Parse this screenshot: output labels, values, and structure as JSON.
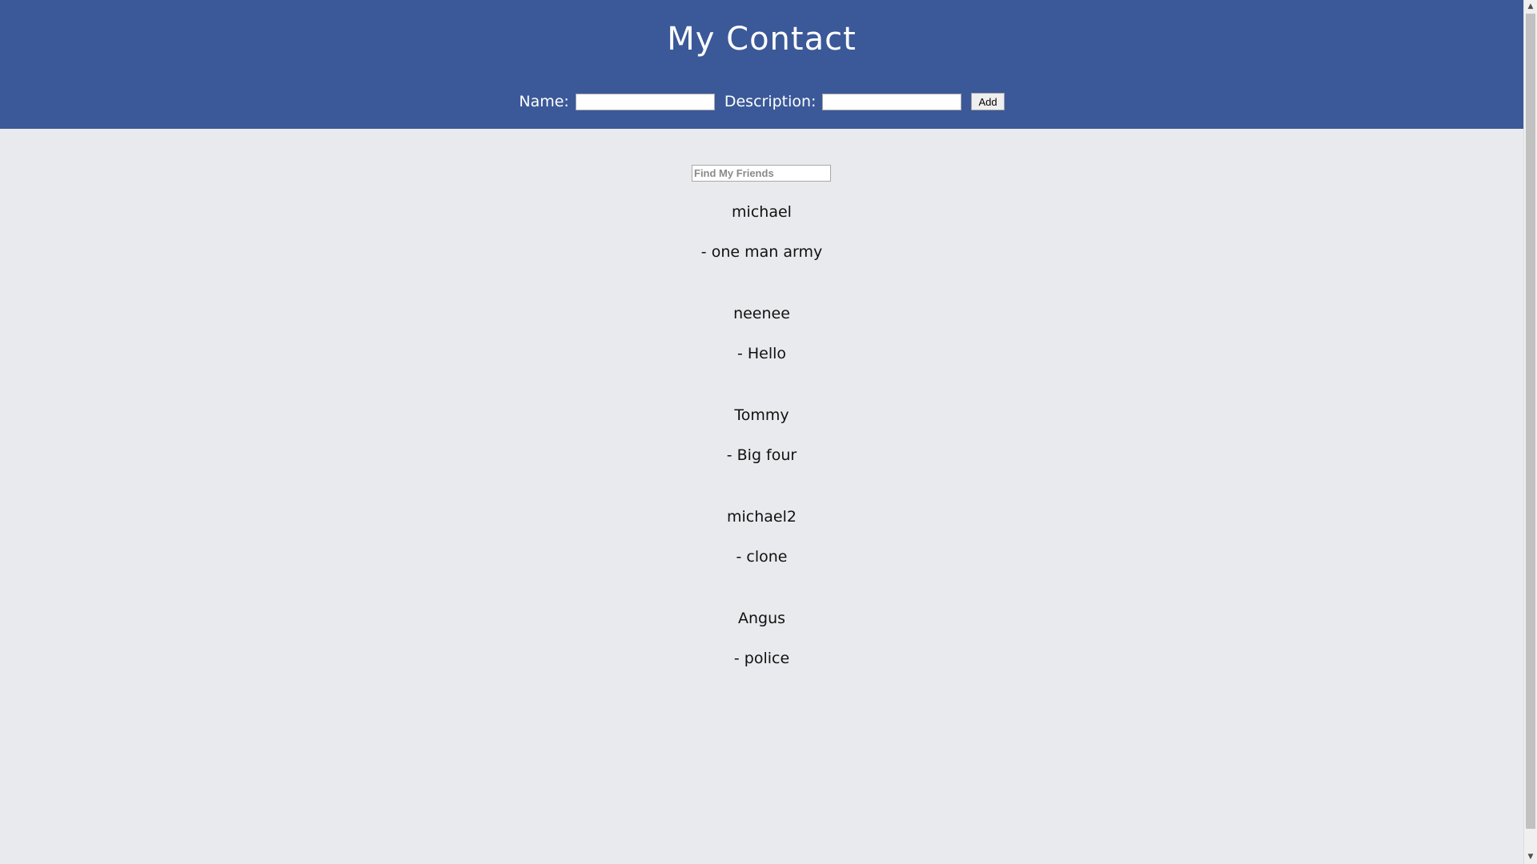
{
  "header": {
    "title": "My Contact",
    "name_label": "Name:",
    "name_value": "",
    "description_label": "Description:",
    "description_value": "",
    "add_label": "Add"
  },
  "search": {
    "placeholder": "Find My Friends",
    "value": ""
  },
  "contacts": [
    {
      "name": "michael",
      "description": "- one man army"
    },
    {
      "name": "neenee",
      "description": "- Hello"
    },
    {
      "name": "Tommy",
      "description": "- Big four"
    },
    {
      "name": "michael2",
      "description": "- clone"
    },
    {
      "name": "Angus",
      "description": "- police"
    }
  ],
  "colors": {
    "header_background": "#3b5998",
    "page_background": "#e9eaed",
    "header_text": "#ffffff"
  },
  "icons": {
    "scroll_up": "arrow-up-icon",
    "scroll_down": "arrow-down-icon"
  }
}
